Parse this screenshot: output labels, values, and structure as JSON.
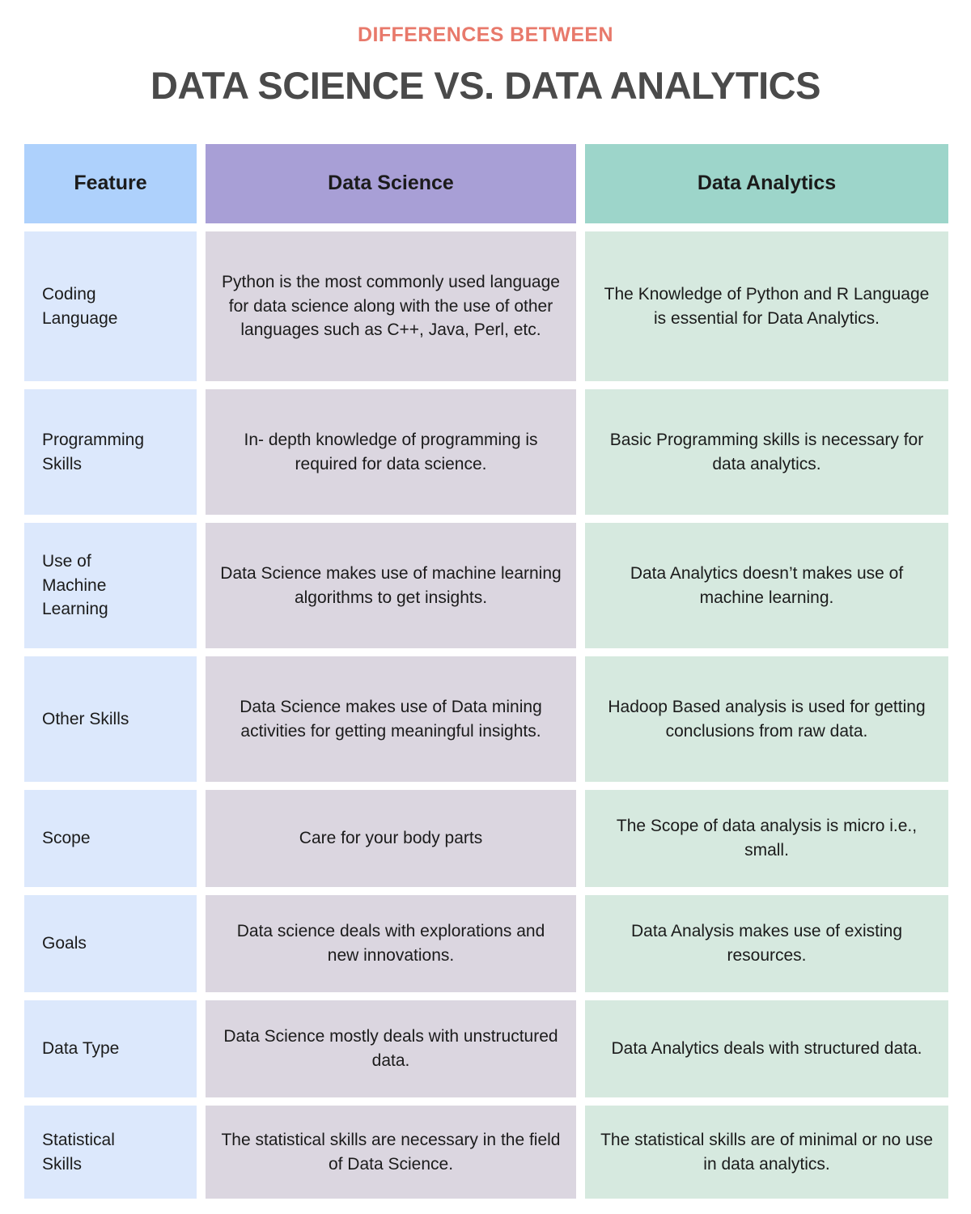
{
  "header": {
    "eyebrow": "DIFFERENCES BETWEEN",
    "title": "DATA SCIENCE VS. DATA ANALYTICS",
    "eyebrow_color": "#E8796B",
    "title_color": "#4A4A4A"
  },
  "table": {
    "columns": [
      {
        "label": "Feature",
        "header_color": "#AED1FC",
        "body_color": "#DCE8FC"
      },
      {
        "label": "Data Science",
        "header_color": "#A89FD6",
        "body_color": "#DBD6E0"
      },
      {
        "label": "Data Analytics",
        "header_color": "#9DD5CA",
        "body_color": "#D6E9DF"
      }
    ],
    "rows": [
      {
        "feature": "Coding\nLanguage",
        "data_science": "Python is the most commonly used language for data science along with the use of other languages such as C++, Java, Perl, etc.",
        "data_analytics": "The Knowledge of Python and R Language is essential for Data Analytics."
      },
      {
        "feature": "Programming\nSkills",
        "data_science": "In- depth knowledge of programming is required for data science.",
        "data_analytics": "Basic Programming skills is necessary for data analytics."
      },
      {
        "feature": "Use of\nMachine\nLearning",
        "data_science": "Data Science makes use of machine learning algorithms to get insights.",
        "data_analytics": "Data Analytics doesn’t makes use of machine learning."
      },
      {
        "feature": "Other Skills",
        "data_science": "Data Science makes use of Data mining activities for getting meaningful insights.",
        "data_analytics": "Hadoop Based analysis is used for getting conclusions from raw data."
      },
      {
        "feature": "Scope",
        "data_science": "Care for your body parts",
        "data_analytics": "The Scope of data analysis is micro i.e., small."
      },
      {
        "feature": "Goals",
        "data_science": "Data science deals with explorations and new innovations.",
        "data_analytics": "Data Analysis makes use of existing resources."
      },
      {
        "feature": "Data Type",
        "data_science": "Data Science mostly deals with unstructured data.",
        "data_analytics": "Data Analytics deals with structured data."
      },
      {
        "feature": "Statistical\nSkills",
        "data_science": "The statistical skills are necessary in the field of Data Science.",
        "data_analytics": "The statistical skills are of minimal or no use in data analytics."
      }
    ]
  }
}
